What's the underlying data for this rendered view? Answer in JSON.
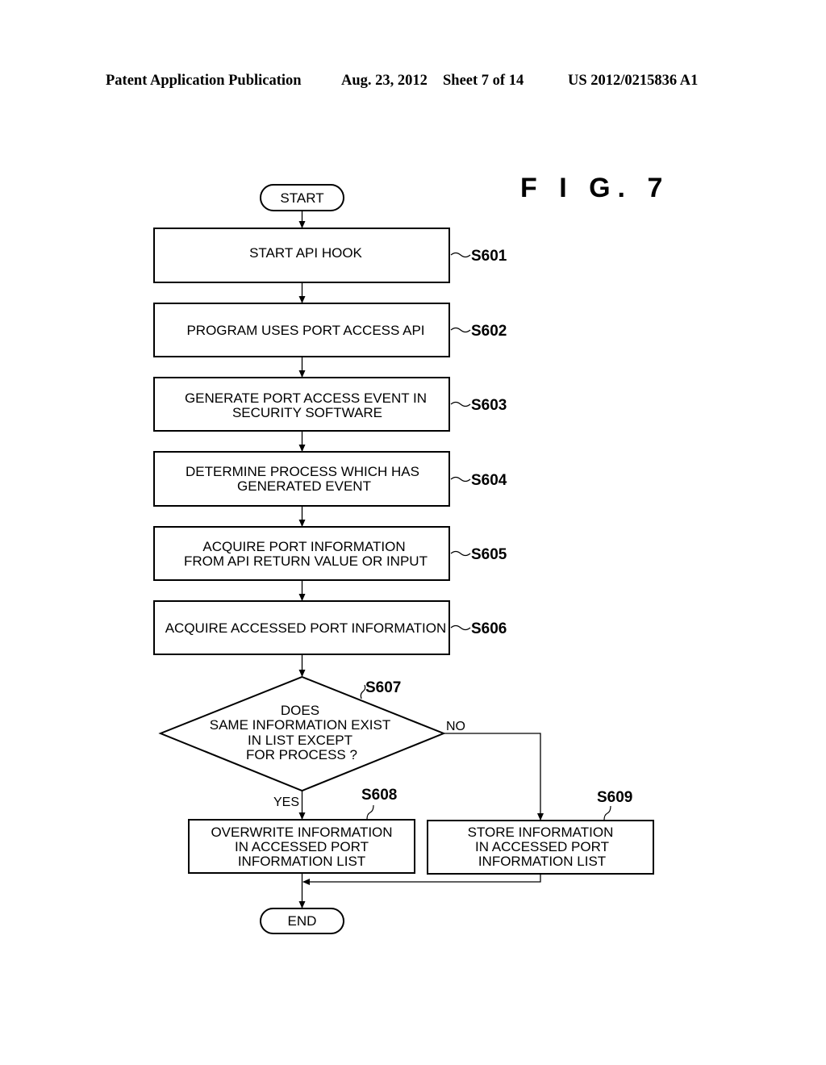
{
  "header": {
    "publication": "Patent Application Publication",
    "date": "Aug. 23, 2012",
    "sheet": "Sheet 7 of 14",
    "number": "US 2012/0215836 A1"
  },
  "figure": {
    "title": "F I G.  7"
  },
  "flowchart": {
    "start": "START",
    "end": "END",
    "steps": [
      {
        "id": "S601",
        "lines": [
          "START API HOOK"
        ]
      },
      {
        "id": "S602",
        "lines": [
          "PROGRAM USES PORT ACCESS API"
        ]
      },
      {
        "id": "S603",
        "lines": [
          "GENERATE PORT ACCESS EVENT IN",
          "SECURITY SOFTWARE"
        ]
      },
      {
        "id": "S604",
        "lines": [
          "DETERMINE  PROCESS WHICH HAS",
          "GENERATED EVENT"
        ]
      },
      {
        "id": "S605",
        "lines": [
          "ACQUIRE PORT INFORMATION",
          "FROM API RETURN VALUE OR INPUT"
        ]
      },
      {
        "id": "S606",
        "lines": [
          "ACQUIRE ACCESSED PORT INFORMATION"
        ]
      }
    ],
    "decision": {
      "id": "S607",
      "lines": [
        "DOES",
        "SAME INFORMATION EXIST",
        "IN LIST EXCEPT",
        "FOR PROCESS ?"
      ],
      "yes_label": "YES",
      "no_label": "NO"
    },
    "yes_step": {
      "id": "S608",
      "lines": [
        "OVERWRITE INFORMATION",
        "IN ACCESSED PORT",
        "INFORMATION LIST"
      ]
    },
    "no_step": {
      "id": "S609",
      "lines": [
        "STORE INFORMATION",
        "IN ACCESSED PORT",
        "INFORMATION LIST"
      ]
    }
  }
}
